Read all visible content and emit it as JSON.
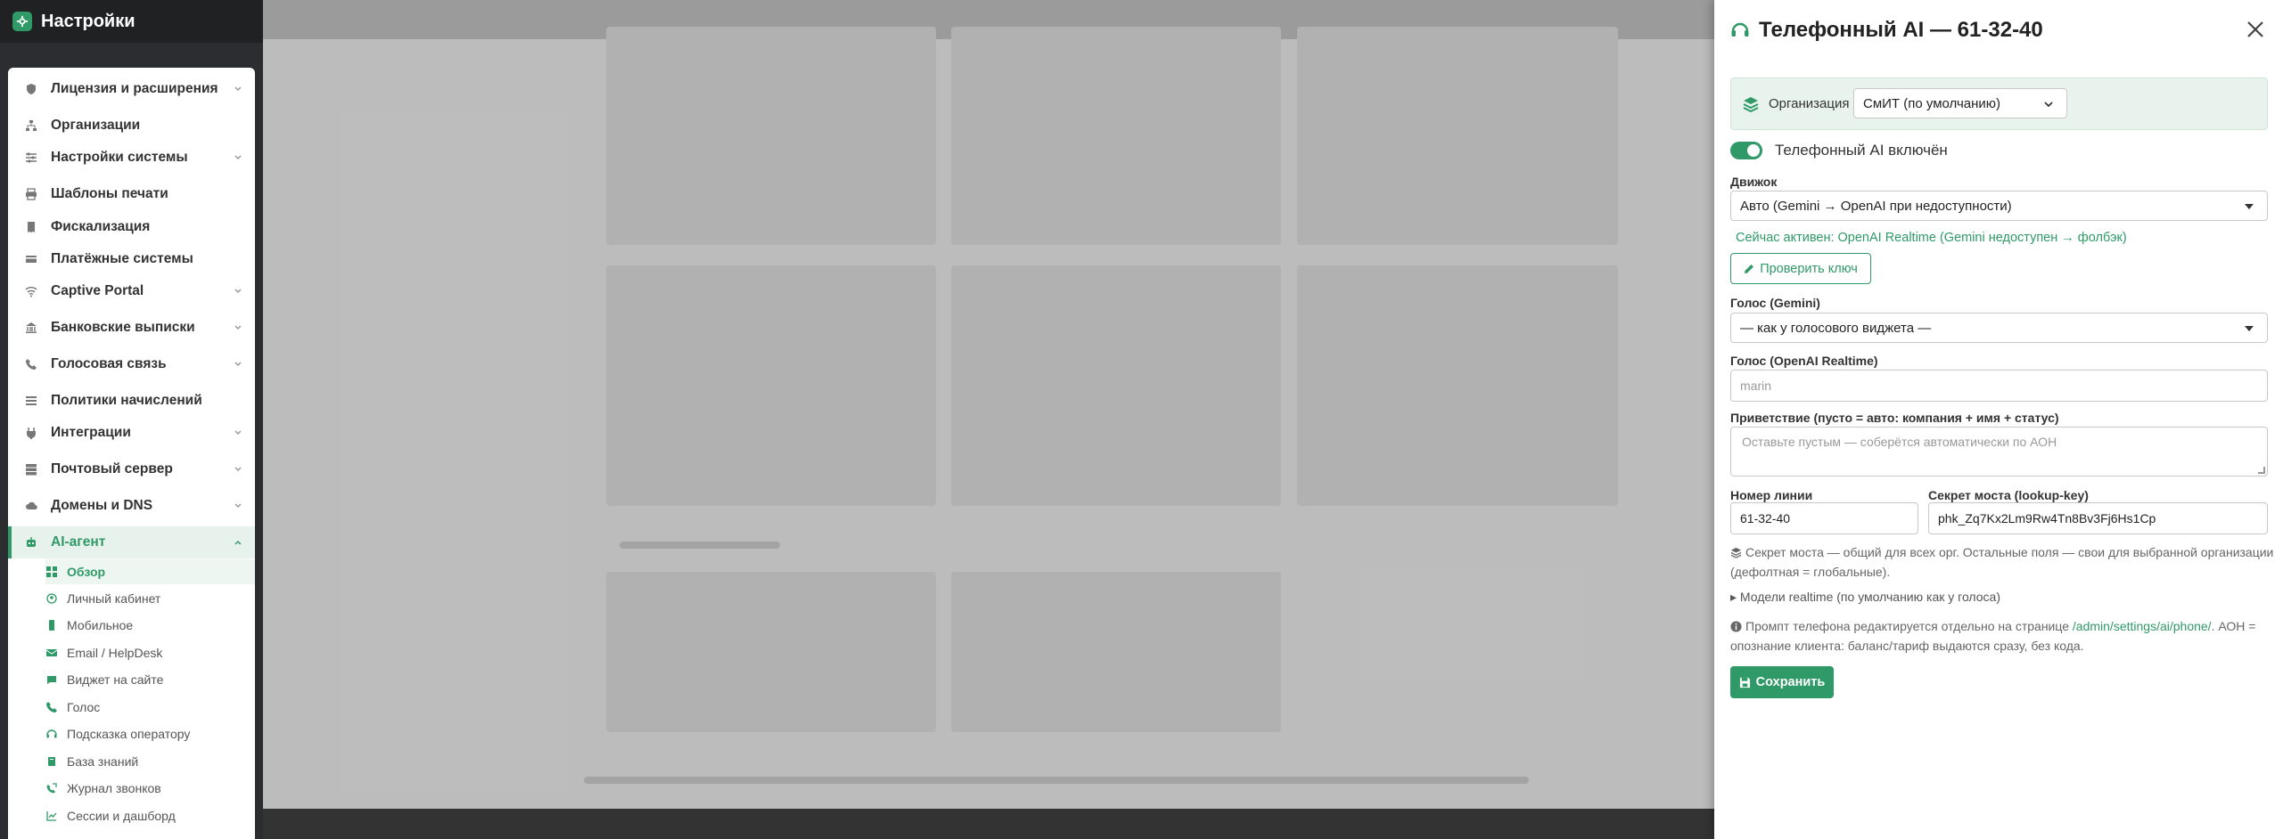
{
  "app": {
    "title": "Настройки"
  },
  "sidebar": {
    "items": [
      {
        "label": "Лицензия и расширения",
        "icon": "shield-icon",
        "has_children": true
      },
      {
        "label": "Организации",
        "icon": "sitemap-icon",
        "has_children": false
      },
      {
        "label": "Настройки системы",
        "icon": "sliders-icon",
        "has_children": true
      },
      {
        "label": "Шаблоны печати",
        "icon": "printer-icon",
        "has_children": false
      },
      {
        "label": "Фискализация",
        "icon": "receipt-icon",
        "has_children": false
      },
      {
        "label": "Платёжные системы",
        "icon": "credit-card-icon",
        "has_children": false
      },
      {
        "label": "Captive Portal",
        "icon": "wifi-icon",
        "has_children": true
      },
      {
        "label": "Банковские выписки",
        "icon": "bank-icon",
        "has_children": true
      },
      {
        "label": "Голосовая связь",
        "icon": "phone-icon",
        "has_children": true
      },
      {
        "label": "Политики начислений",
        "icon": "list-icon",
        "has_children": false
      },
      {
        "label": "Интеграции",
        "icon": "plug-icon",
        "has_children": true
      },
      {
        "label": "Почтовый сервер",
        "icon": "server-icon",
        "has_children": true
      },
      {
        "label": "Домены и DNS",
        "icon": "cloud-icon",
        "has_children": true
      },
      {
        "label": "AI-агент",
        "icon": "robot-icon",
        "has_children": true,
        "active": true
      }
    ],
    "ai_sub_items": [
      {
        "label": "Обзор",
        "icon": "grid-icon",
        "active": true
      },
      {
        "label": "Личный кабинет",
        "icon": "user-circle-icon"
      },
      {
        "label": "Мобильное",
        "icon": "mobile-icon"
      },
      {
        "label": "Email / HelpDesk",
        "icon": "envelope-icon"
      },
      {
        "label": "Виджет на сайте",
        "icon": "chat-icon"
      },
      {
        "label": "Голос",
        "icon": "phone-icon"
      },
      {
        "label": "Подсказка оператору",
        "icon": "headset-icon"
      },
      {
        "label": "База знаний",
        "icon": "book-icon"
      },
      {
        "label": "Журнал звонков",
        "icon": "phone-log-icon"
      },
      {
        "label": "Сессии и дашборд",
        "icon": "chart-icon"
      }
    ]
  },
  "drawer": {
    "title": "Телефонный AI — 61-32-40",
    "organization_label": "Организация",
    "organization_value": "СмИТ (по умолчанию)",
    "enabled_label": "Телефонный AI включён",
    "enabled": true,
    "engine_label": "Движок",
    "engine_value": "Авто (Gemini → OpenAI при недоступности)",
    "active_note": "Сейчас активен: OpenAI Realtime (Gemini недоступен → фолбэк)",
    "check_key_button": "Проверить ключ",
    "voice_gemini_label": "Голос (Gemini)",
    "voice_gemini_value": "— как у голосового виджета —",
    "voice_openai_label": "Голос (OpenAI Realtime)",
    "voice_openai_placeholder": "marin",
    "greeting_label": "Приветствие (пусто = авто: компания + имя + статус)",
    "greeting_placeholder": "Оставьте пустым — соберётся автоматически по АОН",
    "line_label": "Номер линии",
    "line_value": "61-32-40",
    "secret_label": "Секрет моста (lookup-key)",
    "secret_value": "phk_Zq7Kx2Lm9Rw4Tn8Bv3Fj6Hs1Cp",
    "secret_note": "Секрет моста — общий для всех орг. Остальные поля — свои для выбранной организации (дефолтная = глобальные).",
    "realtime_models": "Модели realtime (по умолчанию как у голоса)",
    "prompt_note_pre": "Промпт телефона редактируется отдельно на странице",
    "prompt_note_link": "/admin/settings/ai/phone/",
    "prompt_note_post": ". АОН = опознание клиента: баланс/тариф выдаются сразу, без кода.",
    "save_button": "Сохранить"
  },
  "colors": {
    "accent": "#2f9a67",
    "accent_light": "#e9f3ed",
    "sidebar_dark": "#2b2d30"
  }
}
